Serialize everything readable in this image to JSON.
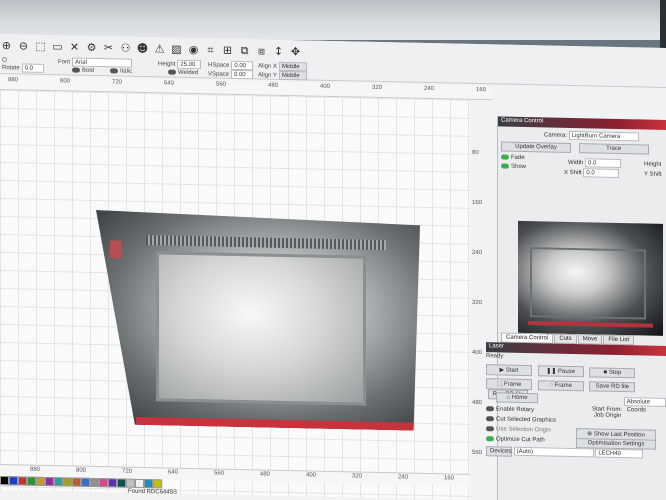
{
  "toolbar": {
    "icons": [
      "zoom-in-icon",
      "zoom-out-icon",
      "select-window-icon",
      "monitor-icon",
      "tools-icon",
      "settings-gear-icon",
      "scissors-icon",
      "users-icon",
      "user-icon",
      "warning-icon",
      "image-icon",
      "node-icon",
      "weld-icon",
      "position-icon",
      "array-icon",
      "align-icon",
      "flip-icon",
      "move-icon"
    ],
    "icon_glyphs": [
      "⊕",
      "⊖",
      "⬚",
      "▭",
      "✕",
      "⚙",
      "✂",
      "⚇",
      "☻",
      "⚠",
      "▨",
      "◉",
      "⌗",
      "⊞",
      "⧉",
      "⧈",
      "↕",
      "✥"
    ],
    "rotate_label": "Rotate",
    "rotate_value": "0.0",
    "font_label": "Font",
    "font_value": "Arial",
    "height_label": "Height",
    "height_value": "25.00",
    "hspace_label": "HSpace",
    "hspace_value": "0.00",
    "vspace_label": "VSpace",
    "vspace_value": "0.00",
    "align_x_label": "Align X",
    "align_x_value": "Middle",
    "align_y_label": "Align Y",
    "align_y_value": "Middle",
    "bold_label": "Bold",
    "italic_label": "Italic",
    "welded_label": "Welded"
  },
  "ruler_top": [
    "880",
    "800",
    "720",
    "640",
    "560",
    "480",
    "400",
    "320",
    "240",
    "160"
  ],
  "ruler_side": [
    "80",
    "160",
    "240",
    "320",
    "400",
    "480",
    "560"
  ],
  "ruler_bottom": [
    "880",
    "800",
    "720",
    "640",
    "560",
    "480",
    "400",
    "320",
    "240",
    "160"
  ],
  "palette": [
    "#000000",
    "#1f3dbf",
    "#c43530",
    "#2f8f3a",
    "#c59a2a",
    "#8e2fa0",
    "#2fa0a0",
    "#a0a02f",
    "#c05a2f",
    "#3a6fbf",
    "#8f8f8f",
    "#d04a8a",
    "#5a2fbf",
    "#0f4f4f",
    "#c0c0c0",
    "#f0f0f0",
    "#1a8fbf",
    "#bfbf1a"
  ],
  "status": {
    "found": "Found RDC6445S"
  },
  "camera_control": {
    "title": "Camera Control",
    "camera_label": "Camera:",
    "camera_value": "LightBurn Camera",
    "update_overlay": "Update Overlay",
    "trace": "Trace",
    "fade": "Fade",
    "show": "Show",
    "width_label": "Width",
    "width_value": "0.0",
    "x_shift_label": "X Shift",
    "x_shift_value": "0.0",
    "height_label": "Height",
    "y_shift_label": "Y Shift"
  },
  "panel_tabs": [
    "Camera Control",
    "Cuts",
    "Move",
    "File List"
  ],
  "laser": {
    "title": "Laser",
    "status": "Ready",
    "start": "Start",
    "pause": "Pause",
    "stop": "Stop",
    "frame1": "Frame",
    "frame2": "Frame",
    "save_rd": "Save RD file",
    "run_rd": "Run RD file",
    "home": "Home",
    "start_from_label": "Start From:",
    "start_from_value": "Absolute Coords",
    "job_origin_label": "Job Origin",
    "enable_rotary": "Enable Rotary",
    "cut_selected": "Cut Selected Graphics",
    "use_selection_origin": "Use Selection Origin",
    "optimize_cut": "Optimize Cut Path",
    "show_last_position": "Show Last Position",
    "optimisation_settings": "Optimisation Settings",
    "devices": "Devices",
    "device_value": "(Auto)",
    "controller": "LECH40"
  },
  "bottom_tabs": [
    "Laser",
    "Library"
  ]
}
